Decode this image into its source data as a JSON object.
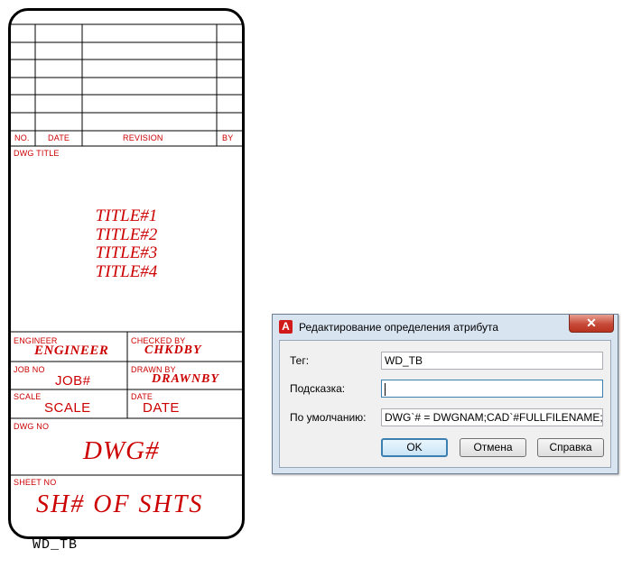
{
  "title_block": {
    "revision_header": {
      "no": "NO.",
      "date": "DATE",
      "revision": "REVISION",
      "by": "BY"
    },
    "dwg_title_label": "DWG TITLE",
    "titles": [
      "TITLE#1",
      "TITLE#2",
      "TITLE#3",
      "TITLE#4"
    ],
    "engineer_label": "ENGINEER",
    "engineer_value": "ENGINEER",
    "checked_label": "CHECKED BY",
    "checked_value": "CHKDBY",
    "job_label": "JOB NO",
    "job_value": "JOB#",
    "drawn_label": "DRAWN BY",
    "drawn_value": "DRAWNBY",
    "scale_label": "SCALE",
    "scale_value": "SCALE",
    "date_label": "DATE",
    "date_value": "DATE",
    "dwgno_label": "DWG NO",
    "dwgno_value": "DWG#",
    "sheet_label": "SHEET NO",
    "sheet_value": "SH# OF SHTS",
    "caption": "WD_TB",
    "color": "#cc0000"
  },
  "dialog": {
    "title": "Редактирование определения атрибута",
    "close_symbol": "✕",
    "app_icon_letter": "A",
    "fields": {
      "tag_label": "Тег:",
      "tag_value": "WD_TB",
      "prompt_label": "Подсказка:",
      "prompt_value": "",
      "default_label": "По умолчанию:",
      "default_value": "DWG`# = DWGNAM;CAD`#FULLFILENAME;SH"
    },
    "buttons": {
      "ok": "OK",
      "cancel": "Отмена",
      "help": "Справка"
    }
  }
}
